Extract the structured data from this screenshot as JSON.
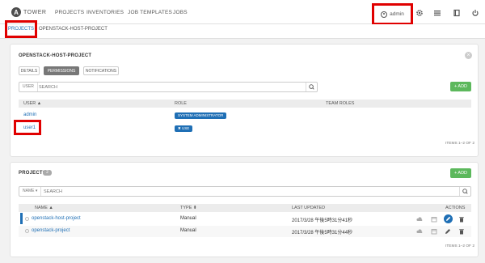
{
  "nav": {
    "logo_letter": "A",
    "logo_text": "TOWER",
    "links": [
      "PROJECTS",
      "INVENTORIES",
      "JOB TEMPLATES",
      "JOBS"
    ],
    "user": "admin"
  },
  "breadcrumb": {
    "root": "PROJECTS",
    "current": "OPENSTACK-HOST-PROJECT"
  },
  "detail_card": {
    "title": "OPENSTACK-HOST-PROJECT",
    "tabs": [
      "DETAILS",
      "PERMISSIONS",
      "NOTIFICATIONS"
    ],
    "active_tab": "PERMISSIONS",
    "search_key": "USER",
    "search_placeholder": "SEARCH",
    "add_label": "+ ADD",
    "columns": [
      "USER ▲",
      "ROLE",
      "TEAM ROLES"
    ],
    "rows": [
      {
        "user": "admin",
        "role": "SYSTEM ADMINISTRATOR"
      },
      {
        "user": "user1",
        "role": "✖ USE"
      }
    ],
    "items_count": "ITEMS 1–2 OF 2"
  },
  "projects_card": {
    "title": "PROJECTS",
    "count": "2",
    "add_label": "+ ADD",
    "search_key": "NAME ▾",
    "search_placeholder": "SEARCH",
    "columns": [
      "NAME ▲",
      "TYPE ⬍",
      "LAST UPDATED",
      "ACTIONS"
    ],
    "rows": [
      {
        "name": "openstack-host-project",
        "type": "Manual",
        "updated": "2017/3/28 午後5時31分41秒"
      },
      {
        "name": "openstack-project",
        "type": "Manual",
        "updated": "2017/3/28 午後5時31分44秒"
      }
    ],
    "items_count": "ITEMS 1–2 OF 2"
  },
  "colors": {
    "accent": "#1f6fb5",
    "add": "#5cb85c",
    "highlight": "#e00000"
  }
}
